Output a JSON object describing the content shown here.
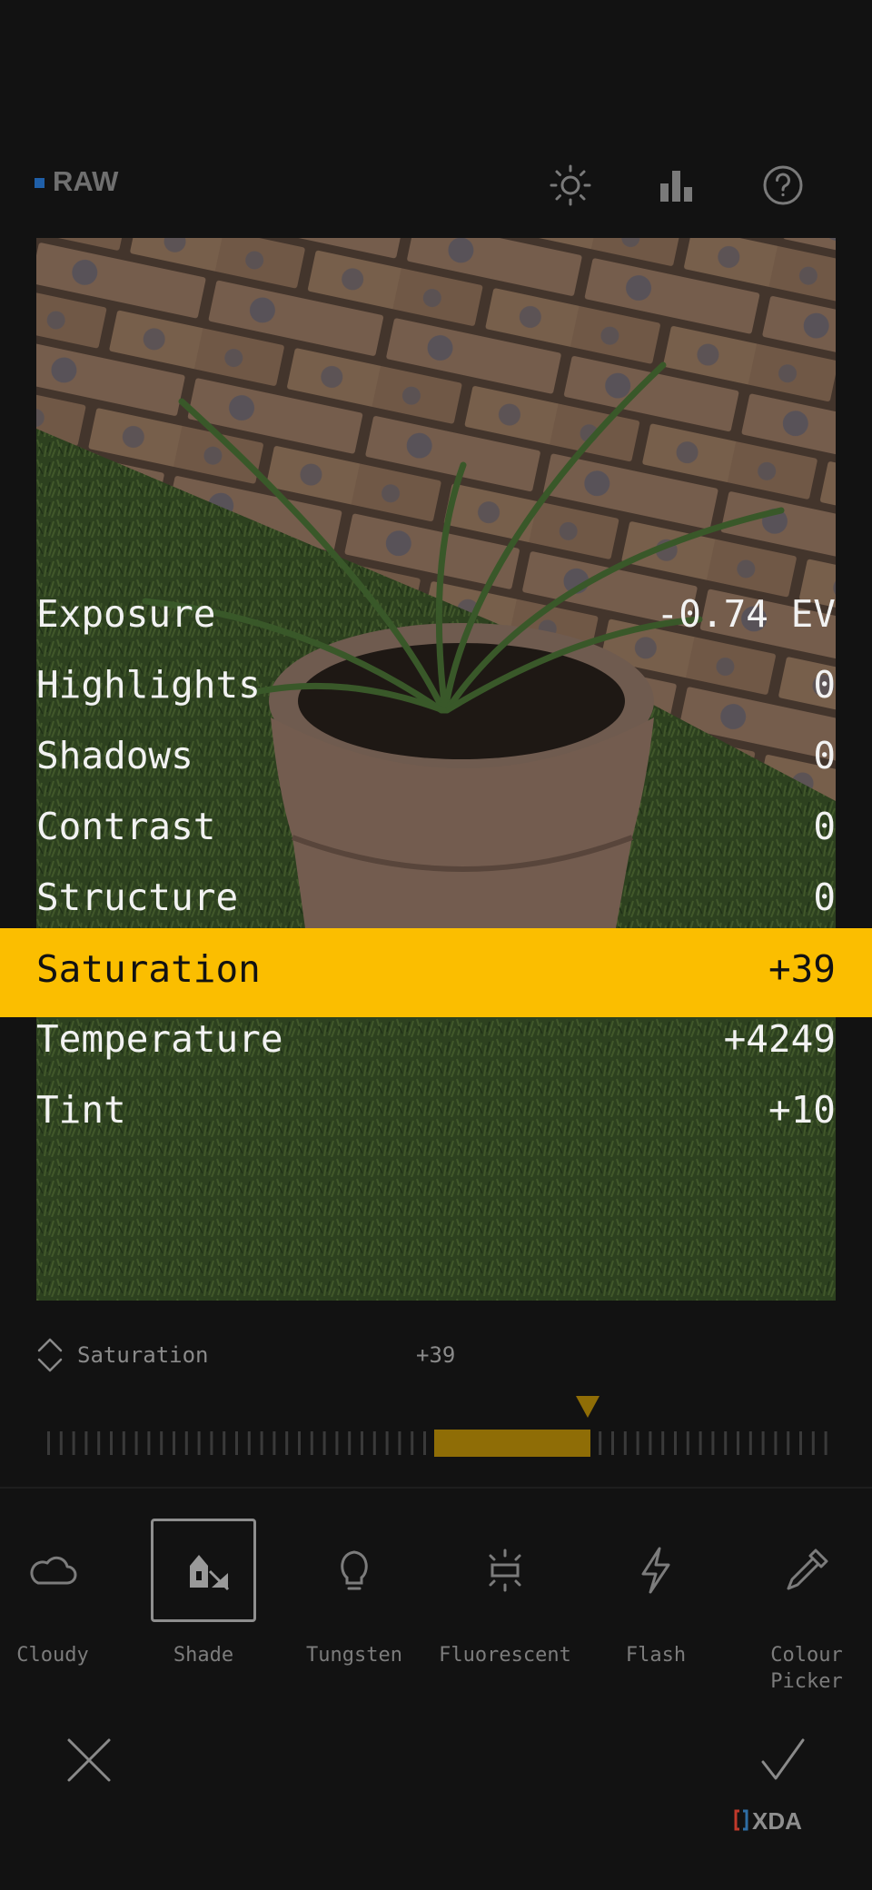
{
  "header": {
    "format_label": "RAW",
    "icons": [
      "sun-icon",
      "histogram-icon",
      "help-icon"
    ]
  },
  "adjustments": [
    {
      "name": "Exposure",
      "value": "-0.74 EV"
    },
    {
      "name": "Highlights",
      "value": "0"
    },
    {
      "name": "Shadows",
      "value": "0"
    },
    {
      "name": "Contrast",
      "value": "0"
    },
    {
      "name": "Structure",
      "value": "0"
    },
    {
      "name": "Saturation",
      "value": "+39",
      "selected": true
    },
    {
      "name": "Temperature",
      "value": "+4249"
    },
    {
      "name": "Tint",
      "value": "+10"
    }
  ],
  "slider": {
    "label": "Saturation",
    "value": "+39"
  },
  "presets": [
    {
      "label": "Cloudy",
      "icon": "cloud-icon"
    },
    {
      "label": "Shade",
      "icon": "shade-icon",
      "selected": true
    },
    {
      "label": "Tungsten",
      "icon": "bulb-icon"
    },
    {
      "label": "Fluorescent",
      "icon": "fluorescent-icon"
    },
    {
      "label": "Flash",
      "icon": "flash-icon"
    },
    {
      "label": "Colour\nPicker",
      "icon": "eyedropper-icon"
    }
  ],
  "footer": {
    "watermark": "XDA"
  },
  "colors": {
    "accent": "#fbbe00",
    "background": "#121212",
    "raw_indicator": "#1f5fa8"
  }
}
